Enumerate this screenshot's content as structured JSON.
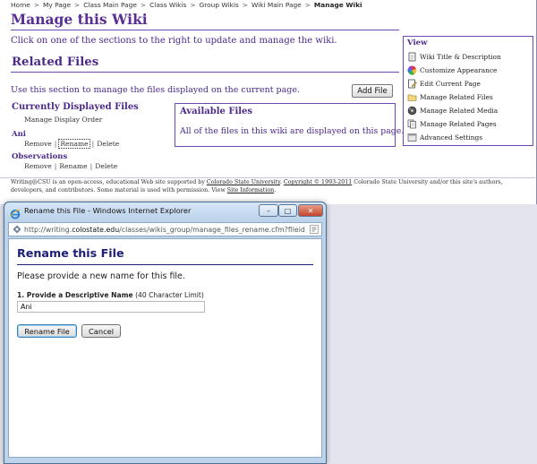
{
  "breadcrumbs": [
    "Home",
    "My Page",
    "Class Main Page",
    "Class Wikis",
    "Group Wikis",
    "Wiki Main Page",
    "Manage Wiki"
  ],
  "page": {
    "title": "Manage this Wiki",
    "intro": "Click on one of the sections to the right to update and manage the wiki.",
    "section_title": "Related Files",
    "section_desc": "Use this section to manage the files displayed on the current page.",
    "add_file_label": "Add File",
    "current_files_title": "Currently Displayed Files",
    "manage_order_label": "Manage Display Order",
    "files": [
      {
        "name": "Ani",
        "remove": "Remove",
        "rename": "Rename",
        "delete": "Delete"
      },
      {
        "name": "Observations",
        "remove": "Remove",
        "rename": "Rename",
        "delete": "Delete"
      }
    ],
    "available_title": "Available Files",
    "available_desc": "All of the files in this wiki are displayed on this page."
  },
  "view_panel": {
    "title": "View",
    "items": [
      {
        "label": "Wiki Title & Description",
        "icon": "page-edit-icon"
      },
      {
        "label": "Customize Appearance",
        "icon": "color-wheel-icon"
      },
      {
        "label": "Edit Current Page",
        "icon": "pencil-page-icon"
      },
      {
        "label": "Manage Related Files",
        "icon": "folder-icon"
      },
      {
        "label": "Manage Related Media",
        "icon": "media-icon"
      },
      {
        "label": "Manage Related Pages",
        "icon": "pages-icon"
      },
      {
        "label": "Advanced Settings",
        "icon": "settings-box-icon"
      }
    ]
  },
  "footer": {
    "part1": "Writing@CSU is an open-access, educational Web site supported by ",
    "link1": "Colorado State University",
    "part2": ". ",
    "link2": "Copyright © 1993-2011",
    "part3": " Colorado State University and/or this site's authors, developers, and contributors. Some material is used with permission. View ",
    "link3": "Site Information",
    "part4": "."
  },
  "popup": {
    "window_title": "Rename this File - Windows Internet Explorer",
    "address_prefix": "http://writing.",
    "address_domain": "colostate.edu",
    "address_rest": "/classes/wikis_group/manage_files_rename.cfm?fileid",
    "heading": "Rename this File",
    "prompt": "Please provide a new name for this file.",
    "field_label_bold": "1. Provide a Descriptive Name",
    "field_label_note": " (40 Character Limit)",
    "field_value": "Ani",
    "rename_button": "Rename File",
    "cancel_button": "Cancel"
  }
}
